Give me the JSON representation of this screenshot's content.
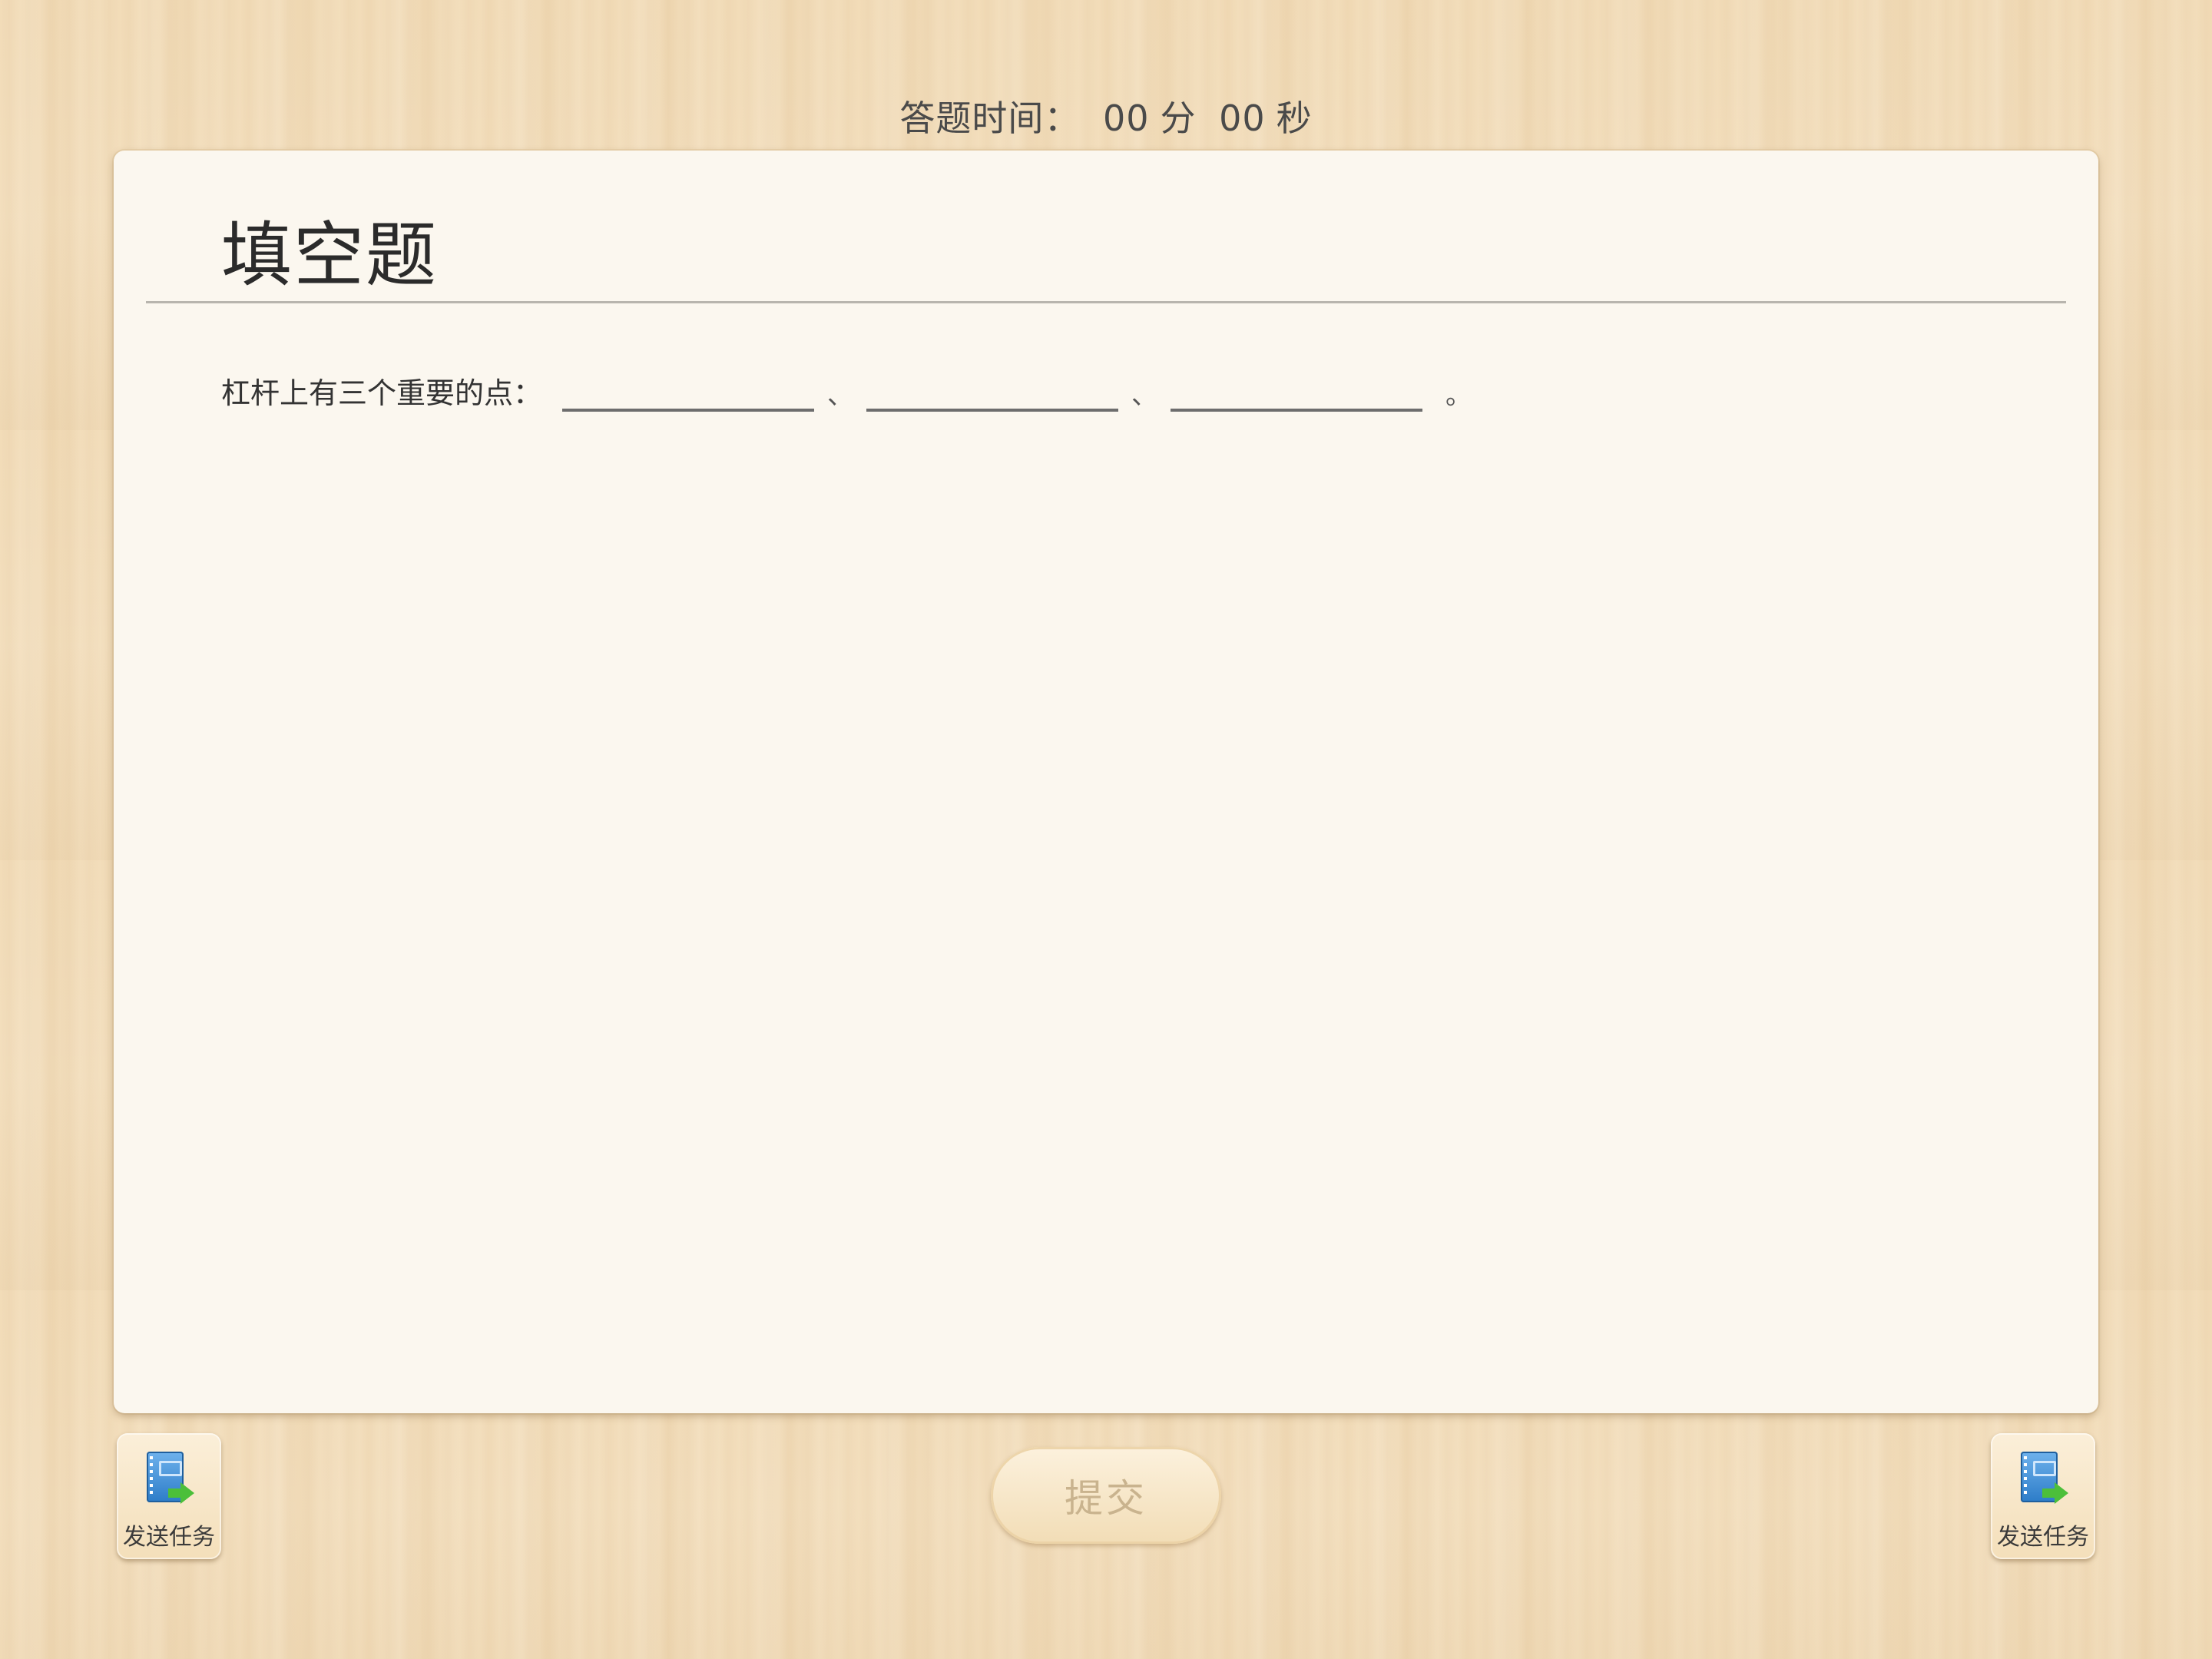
{
  "timer": {
    "label": "答题时间：",
    "minutes": "00",
    "minutes_unit": "分",
    "seconds": "00",
    "seconds_unit": "秒"
  },
  "question_card": {
    "title": "填空题",
    "prompt": "杠杆上有三个重要的点：",
    "separator": "、",
    "end_mark": "。",
    "blanks": [
      {
        "value": ""
      },
      {
        "value": ""
      },
      {
        "value": ""
      }
    ]
  },
  "footer": {
    "left_button": {
      "label": "发送任务",
      "icon": "task-send-icon"
    },
    "submit_button": {
      "label": "提交"
    },
    "right_button": {
      "label": "发送任务",
      "icon": "task-send-icon"
    }
  }
}
